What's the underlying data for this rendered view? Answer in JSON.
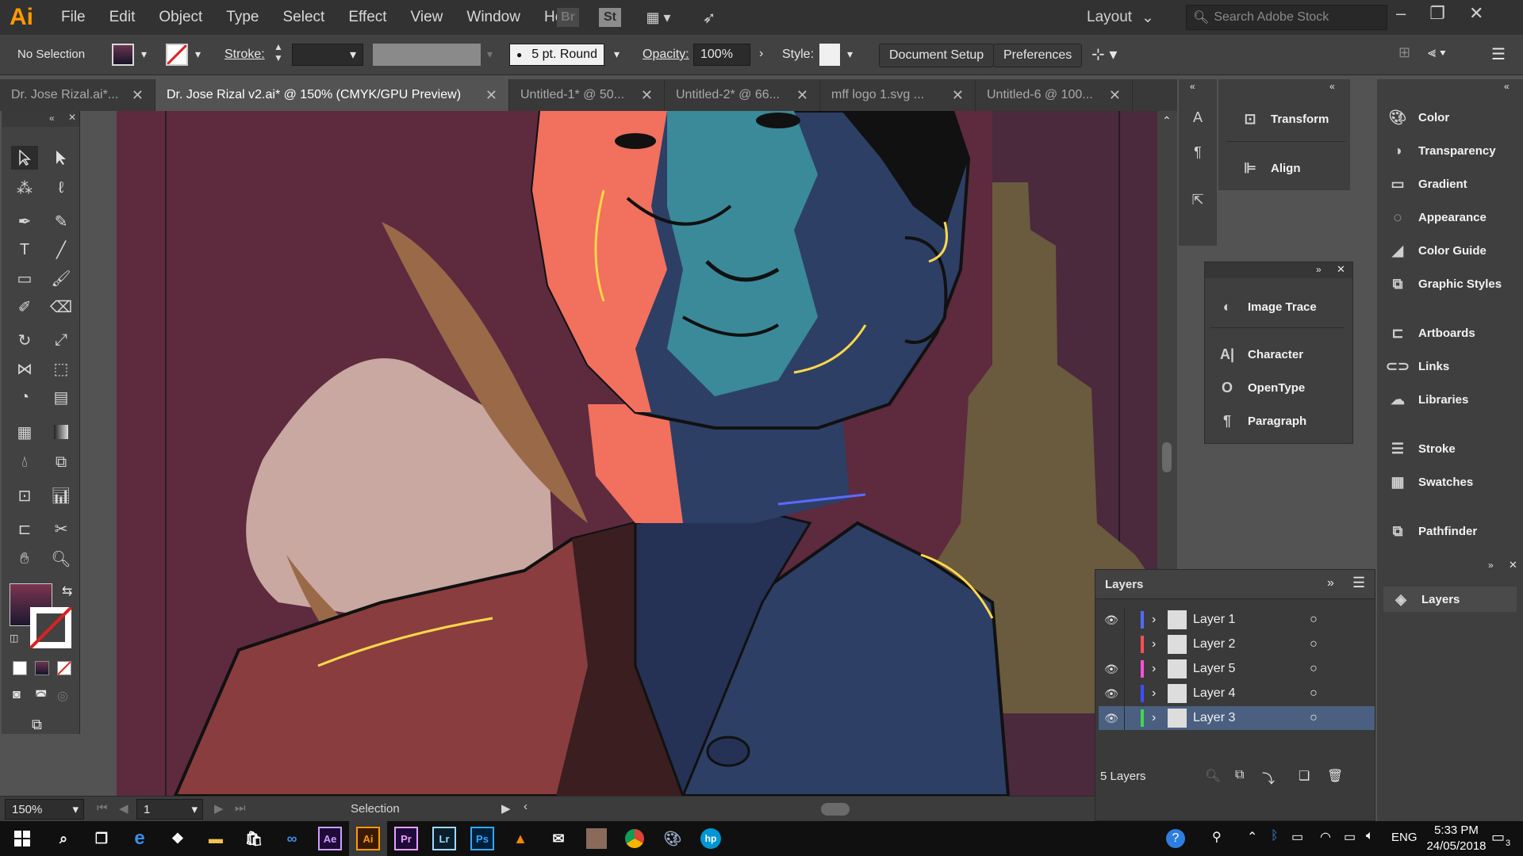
{
  "app": {
    "logo": "Ai"
  },
  "menu": [
    "File",
    "Edit",
    "Object",
    "Type",
    "Select",
    "Effect",
    "View",
    "Window",
    "Help"
  ],
  "appbar": {
    "bridge": "Br",
    "stock_btn": "St",
    "workspace": "Layout",
    "search_placeholder": "Search Adobe Stock"
  },
  "control": {
    "selection": "No Selection",
    "stroke_label": "Stroke:",
    "brush": "5 pt. Round",
    "opacity_label": "Opacity:",
    "opacity_value": "100%",
    "style_label": "Style:",
    "doc_setup": "Document Setup",
    "preferences": "Preferences"
  },
  "tabs": [
    {
      "label": "Dr. Jose Rizal.ai*...",
      "active": false
    },
    {
      "label": "Dr. Jose Rizal v2.ai* @ 150% (CMYK/GPU Preview)",
      "active": true
    },
    {
      "label": "Untitled-1* @ 50...",
      "active": false
    },
    {
      "label": "Untitled-2* @ 66...",
      "active": false
    },
    {
      "label": "mff logo 1.svg ...",
      "active": false
    },
    {
      "label": "Untitled-6 @ 100...",
      "active": false
    }
  ],
  "status": {
    "zoom": "150%",
    "page": "1",
    "tool": "Selection"
  },
  "panels_mid": {
    "transform": "Transform",
    "align": "Align",
    "image_trace": "Image Trace",
    "character": "Character",
    "opentype": "OpenType",
    "paragraph": "Paragraph"
  },
  "panels_right": [
    "Color",
    "Transparency",
    "Gradient",
    "Appearance",
    "Color Guide",
    "Graphic Styles",
    "Artboards",
    "Links",
    "Libraries",
    "Stroke",
    "Swatches",
    "Pathfinder"
  ],
  "layers_panel": {
    "title": "Layers",
    "dock_label": "Layers",
    "count": "5 Layers",
    "layers": [
      {
        "name": "Layer 1",
        "visible": true,
        "color": "#4f6cff",
        "selected": false
      },
      {
        "name": "Layer 2",
        "visible": false,
        "color": "#ff4f4f",
        "selected": false
      },
      {
        "name": "Layer 5",
        "visible": true,
        "color": "#ff4fd8",
        "selected": false
      },
      {
        "name": "Layer 4",
        "visible": true,
        "color": "#3c4fff",
        "selected": false
      },
      {
        "name": "Layer 3",
        "visible": true,
        "color": "#3fd84f",
        "selected": true
      }
    ]
  },
  "taskbar": {
    "apps": [
      "Ae",
      "Ai",
      "Pr",
      "Lr",
      "Ps"
    ],
    "lang": "ENG",
    "time": "5:33 PM",
    "date": "24/05/2018",
    "notif": "3"
  },
  "colors": {
    "accent": "#ff9a00",
    "selected_layer": "#4b6080",
    "canvas_bg": "#5d2a3e"
  }
}
